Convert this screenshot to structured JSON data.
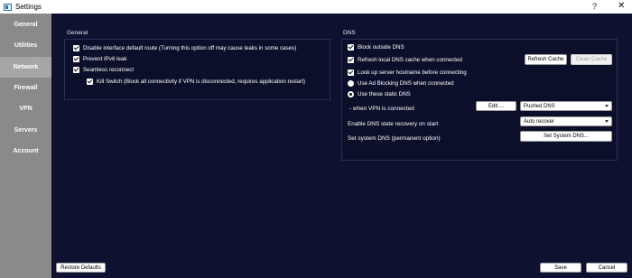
{
  "window": {
    "title": "Settings",
    "help_label": "?",
    "close_label": "✕"
  },
  "sidebar": {
    "items": [
      {
        "label": "General",
        "active": false
      },
      {
        "label": "Utilities",
        "active": false
      },
      {
        "label": "Network",
        "active": true
      },
      {
        "label": "Firewall",
        "active": false
      },
      {
        "label": "VPN",
        "active": false
      },
      {
        "label": "Servers",
        "active": false
      },
      {
        "label": "Account",
        "active": false
      }
    ]
  },
  "general": {
    "title": "General",
    "options": [
      {
        "label": "Disable interface default route (Turning this option off may cause leaks in some cases)",
        "checked": true
      },
      {
        "label": "Prevent IPv6 leak",
        "checked": true
      },
      {
        "label": "Seamless reconnect",
        "checked": true
      },
      {
        "label": "Kill Switch (Block all connectivity if VPN is disconnected, requires application restart)",
        "checked": true
      }
    ]
  },
  "dns": {
    "title": "DNS",
    "block_outside": {
      "label": "Block outside DNS",
      "checked": true
    },
    "refresh_cache": {
      "label": "Refresh local DNS cache when connected",
      "checked": true
    },
    "refresh_cache_button": "Refresh Cache",
    "clean_cache_button": "Clean Cache",
    "lookup_hostname": {
      "label": "Look up server hostname before connecting",
      "checked": true
    },
    "ad_blocking": {
      "label": "Use Ad Blocking DNS when connected",
      "selected": false
    },
    "static_dns": {
      "label": "Use these static DNS",
      "selected": true
    },
    "when_vpn_label": "- when VPN is connected",
    "edit_button": "Edit ...",
    "pushed_dns_value": "Pushed DNS",
    "recovery_label": "Enable DNS state recovery on start",
    "recovery_value": "Auto recover",
    "system_dns_label": "Set system DNS (permanent option)",
    "system_dns_button": "Set System DNS..."
  },
  "footer": {
    "restore_defaults": "Restore Defaults",
    "save": "Save",
    "cancel": "Cancel"
  }
}
